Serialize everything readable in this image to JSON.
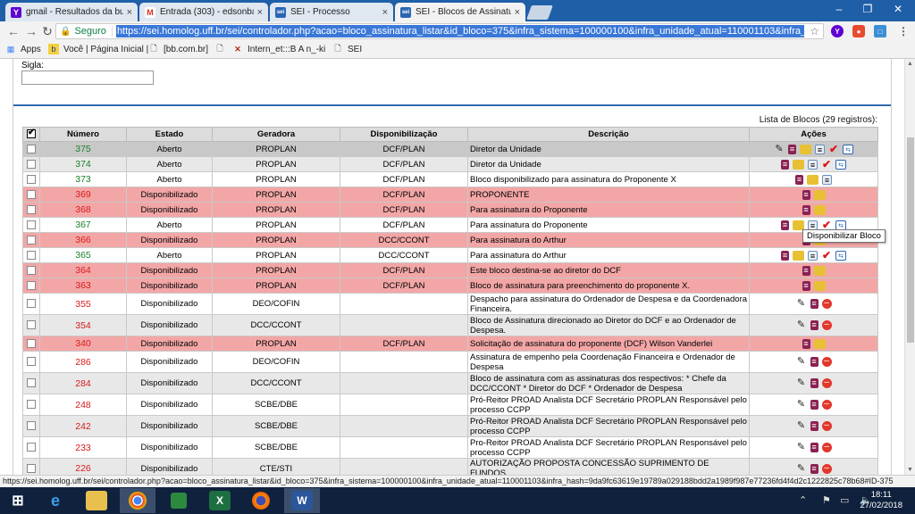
{
  "browser": {
    "tabs": [
      {
        "icon": "Y",
        "label": "gmail - Resultados da bu",
        "active": false
      },
      {
        "icon": "M",
        "label": "Entrada (303) - edsonbat",
        "active": false
      },
      {
        "icon": "sei",
        "label": "SEI - Processo",
        "active": false
      },
      {
        "icon": "sei",
        "label": "SEI - Blocos de Assinatur",
        "active": true
      }
    ],
    "secure_label": "Seguro",
    "url": "https://sei.homolog.uff.br/sei/controlador.php?acao=bloco_assinatura_listar&id_bloco=375&infra_sistema=100000100&infra_unidade_atual=110001103&infra_hash=",
    "bookmarks": [
      {
        "icon": "apps-icon",
        "label": "Apps"
      },
      {
        "icon": "bb-icon",
        "label": "Você | Página Inicial |"
      },
      {
        "icon": "page-icon",
        "label": "[bb.com.br]"
      },
      {
        "icon": "page-icon",
        "label": ""
      },
      {
        "icon": "x-icon",
        "label": "Intern_et:::B A n_-ki"
      },
      {
        "icon": "page-icon",
        "label": "SEI"
      }
    ]
  },
  "page": {
    "sigla_label": "Sigla:",
    "sigla_value": "",
    "list_caption": "Lista de Blocos (29 registros):",
    "tooltip": "Disponibilizar Bloco"
  },
  "table": {
    "headers": [
      "Número",
      "Estado",
      "Geradora",
      "Disponibilização",
      "Descrição",
      "Ações"
    ],
    "rows": [
      {
        "num": "375",
        "estado": "Aberto",
        "geradora": "PROPLAN",
        "disp": "DCF/PLAN",
        "desc": "Diretor da Unidade",
        "style": "sel",
        "numcolor": "green",
        "actions": [
          "pen",
          "book",
          "folder",
          "doc",
          "check",
          "net"
        ]
      },
      {
        "num": "374",
        "estado": "Aberto",
        "geradora": "PROPLAN",
        "disp": "DCF/PLAN",
        "desc": "Diretor da Unidade",
        "style": "gray",
        "numcolor": "green",
        "actions": [
          "book",
          "folder",
          "doc",
          "check",
          "net"
        ]
      },
      {
        "num": "373",
        "estado": "Aberto",
        "geradora": "PROPLAN",
        "disp": "DCF/PLAN",
        "desc": "Bloco disponibilizado para assinatura do Proponente X",
        "style": "white",
        "numcolor": "green",
        "actions": [
          "book",
          "folder",
          "doc"
        ]
      },
      {
        "num": "369",
        "estado": "Disponibilizado",
        "geradora": "PROPLAN",
        "disp": "DCF/PLAN",
        "desc": "PROPONENTE",
        "style": "pink",
        "numcolor": "red",
        "actions": [
          "book",
          "folder"
        ]
      },
      {
        "num": "368",
        "estado": "Disponibilizado",
        "geradora": "PROPLAN",
        "disp": "DCF/PLAN",
        "desc": "Para assinatura do Proponente",
        "style": "pink",
        "numcolor": "red",
        "actions": [
          "book",
          "folder"
        ]
      },
      {
        "num": "367",
        "estado": "Aberto",
        "geradora": "PROPLAN",
        "disp": "DCF/PLAN",
        "desc": "Para assinatura do Proponente",
        "style": "white",
        "numcolor": "green",
        "actions": [
          "book",
          "folder",
          "doc",
          "check",
          "net"
        ]
      },
      {
        "num": "366",
        "estado": "Disponibilizado",
        "geradora": "PROPLAN",
        "disp": "DCC/CCONT",
        "desc": "Para assinatura do Arthur",
        "style": "pink",
        "numcolor": "red",
        "actions": [
          "book",
          "folder"
        ]
      },
      {
        "num": "365",
        "estado": "Aberto",
        "geradora": "PROPLAN",
        "disp": "DCC/CCONT",
        "desc": "Para assinatura do Arthur",
        "style": "white",
        "numcolor": "green",
        "actions": [
          "book",
          "folder",
          "doc",
          "check",
          "net"
        ]
      },
      {
        "num": "364",
        "estado": "Disponibilizado",
        "geradora": "PROPLAN",
        "disp": "DCF/PLAN",
        "desc": "Este bloco destina-se ao diretor do DCF",
        "style": "pink",
        "numcolor": "red",
        "actions": [
          "book",
          "folder"
        ]
      },
      {
        "num": "363",
        "estado": "Disponibilizado",
        "geradora": "PROPLAN",
        "disp": "DCF/PLAN",
        "desc": "Bloco de assinatura para preenchimento do proponente X.",
        "style": "pink",
        "numcolor": "red",
        "actions": [
          "book",
          "folder"
        ]
      },
      {
        "num": "355",
        "estado": "Disponibilizado",
        "geradora": "DEO/COFIN",
        "disp": "",
        "desc": "Despacho para assinatura do Ordenador de Despesa e da Coordenadora Financeira.",
        "style": "white",
        "numcolor": "red",
        "actions": [
          "pen",
          "book",
          "minus"
        ]
      },
      {
        "num": "354",
        "estado": "Disponibilizado",
        "geradora": "DCC/CCONT",
        "disp": "",
        "desc": "Bloco de Assinatura direcionado ao Diretor do DCF e ao Ordenador de Despesa.",
        "style": "gray",
        "numcolor": "red",
        "actions": [
          "pen",
          "book",
          "minus"
        ]
      },
      {
        "num": "340",
        "estado": "Disponibilizado",
        "geradora": "PROPLAN",
        "disp": "DCF/PLAN",
        "desc": "Solicitação de assinatura do proponente (DCF) Wilson Vanderlei",
        "style": "pink",
        "numcolor": "red",
        "actions": [
          "book",
          "folder"
        ]
      },
      {
        "num": "286",
        "estado": "Disponibilizado",
        "geradora": "DEO/COFIN",
        "disp": "",
        "desc": "Assinatura de empenho pela Coordenação Financeira e Ordenador de Despesa",
        "style": "white",
        "numcolor": "red",
        "actions": [
          "pen",
          "book",
          "minus"
        ]
      },
      {
        "num": "284",
        "estado": "Disponibilizado",
        "geradora": "DCC/CCONT",
        "disp": "",
        "desc": "Bloco de assinatura com as assinaturas dos respectivos: * Chefe da DCC/CCONT * Diretor do DCF * Ordenador de Despesa",
        "style": "gray",
        "numcolor": "red",
        "actions": [
          "pen",
          "book",
          "minus"
        ]
      },
      {
        "num": "248",
        "estado": "Disponibilizado",
        "geradora": "SCBE/DBE",
        "disp": "",
        "desc": "Pró-Reitor PROAD Analista DCF Secretário PROPLAN Responsável pelo processo CCPP",
        "style": "white",
        "numcolor": "red",
        "actions": [
          "pen",
          "book",
          "minus"
        ]
      },
      {
        "num": "242",
        "estado": "Disponibilizado",
        "geradora": "SCBE/DBE",
        "disp": "",
        "desc": "Pró-Reitor PROAD Analista DCF Secretário PROPLAN Responsável pelo processo CCPP",
        "style": "gray",
        "numcolor": "red",
        "actions": [
          "pen",
          "book",
          "minus"
        ]
      },
      {
        "num": "233",
        "estado": "Disponibilizado",
        "geradora": "SCBE/DBE",
        "disp": "",
        "desc": "Pro-Reitor PROAD Analista DCF Secretário PROPLAN Responsável pelo processo CCPP",
        "style": "white",
        "numcolor": "red",
        "actions": [
          "pen",
          "book",
          "minus"
        ]
      },
      {
        "num": "226",
        "estado": "Disponibilizado",
        "geradora": "CTE/STI",
        "disp": "",
        "desc": "AUTORIZAÇÃO PROPOSTA CONCESSÃO SUPRIMENTO DE FUNDOS",
        "style": "gray",
        "numcolor": "red",
        "actions": [
          "pen",
          "book",
          "minus"
        ]
      }
    ]
  },
  "status_url": "https://sei.homolog.uff.br/sei/controlador.php?acao=bloco_assinatura_listar&id_bloco=375&infra_sistema=100000100&infra_unidade_atual=110001103&infra_hash=9da9fc63619e19789a029188bdd2a1989f987e77236fd4f4d2c1222825c78b68#ID-375",
  "taskbar": {
    "items": [
      "start-icon",
      "ie-icon",
      "explorer-icon",
      "chrome-icon",
      "store-icon",
      "excel-icon",
      "firefox-icon",
      "word-icon"
    ],
    "time": "18:11",
    "date": "27/02/2018"
  },
  "colors": {
    "tabbar": "#1f5fa8",
    "pink_row": "#f3a6a6",
    "header_row": "#dcdcdc",
    "green_number": "#1a7f2a",
    "red_number": "#d61c1c",
    "rule_blue": "#2d6bb0"
  }
}
